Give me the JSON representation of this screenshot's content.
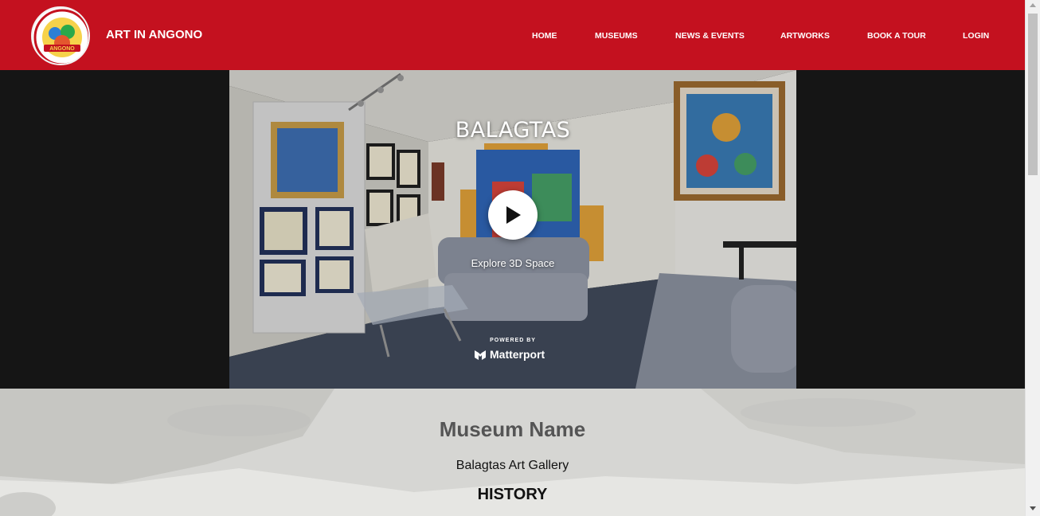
{
  "header": {
    "brand": "ART IN ANGONO",
    "logo_text": "ANGONO",
    "nav": [
      {
        "label": "HOME"
      },
      {
        "label": "MUSEUMS"
      },
      {
        "label": "NEWS & EVENTS"
      },
      {
        "label": "ARTWORKS"
      },
      {
        "label": "BOOK A TOUR"
      },
      {
        "label": "LOGIN"
      }
    ]
  },
  "tour": {
    "title": "BALAGTAS",
    "explore_label": "Explore 3D Space",
    "powered_by": "POWERED BY",
    "provider": "Matterport"
  },
  "content": {
    "museum_title": "Museum Name",
    "museum_name": "Balagtas Art Gallery",
    "history_heading": "HISTORY"
  },
  "colors": {
    "header_bg": "#c4111f",
    "hero_bg": "#151515",
    "content_bg": "#d7d7d5"
  }
}
